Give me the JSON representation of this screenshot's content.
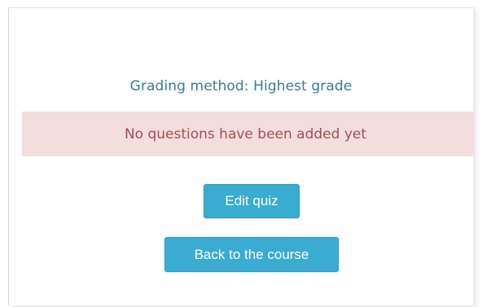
{
  "quiz": {
    "grading_method": "Grading method: Highest grade",
    "notice": "No questions have been added yet"
  },
  "actions": {
    "edit_label": "Edit quiz",
    "back_label": "Back to the course"
  },
  "colors": {
    "button": "#3aabd1",
    "alert_background": "#f3dede",
    "alert_text": "#a0514c",
    "info_text": "#3c7c8c"
  }
}
